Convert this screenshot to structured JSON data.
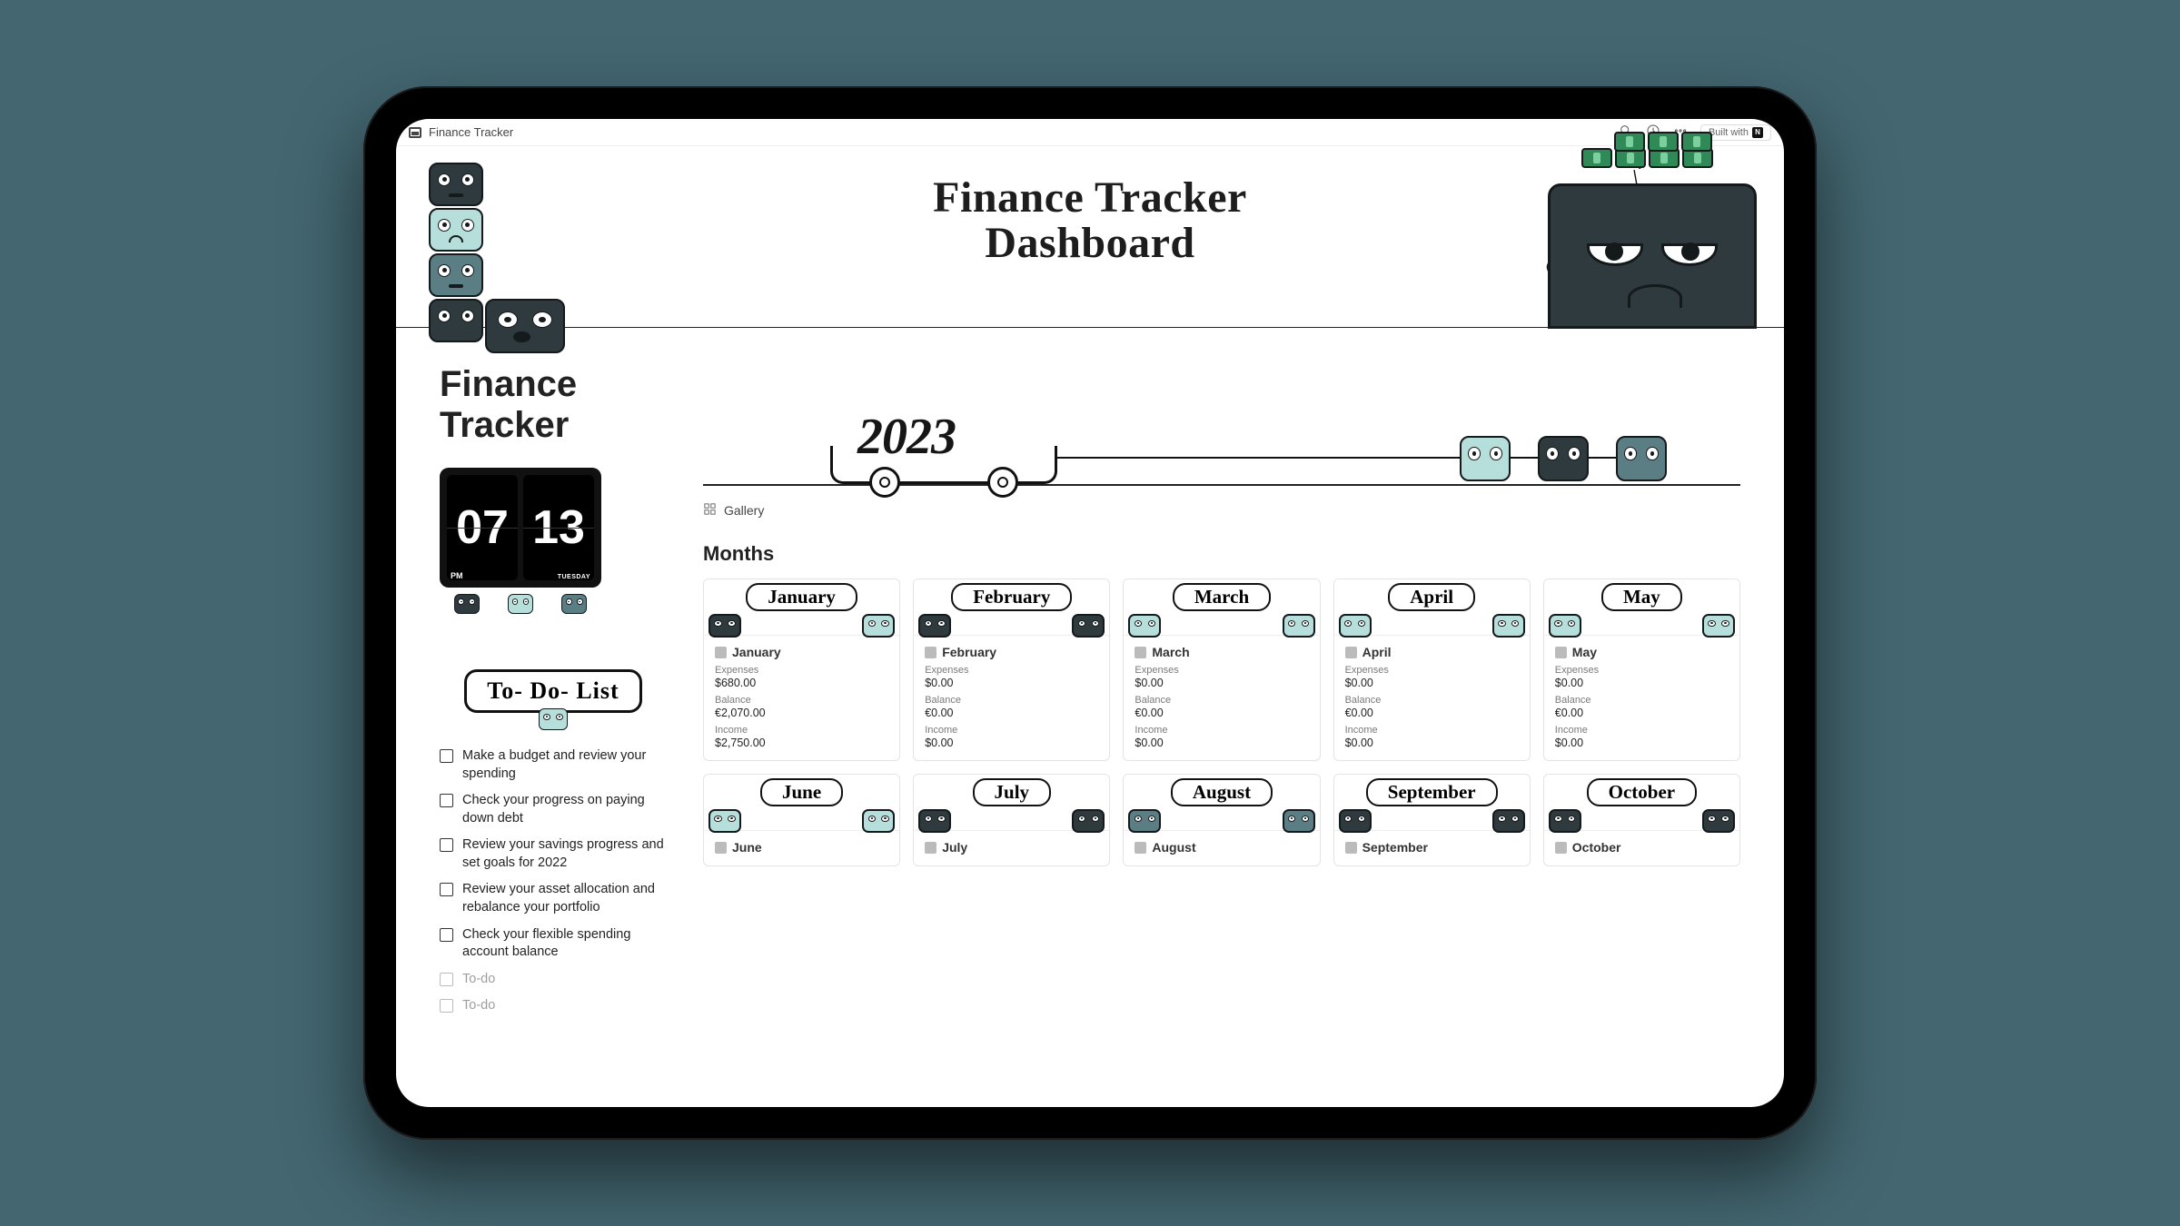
{
  "topbar": {
    "breadcrumb": "Finance Tracker",
    "built_with": "Built with"
  },
  "hero": {
    "title_line1": "Finance Tracker",
    "title_line2": "Dashboard"
  },
  "page_title": "Finance Tracker",
  "clock": {
    "hour": "07",
    "minute": "13",
    "ampm": "PM",
    "dow": "TUESDAY"
  },
  "illustration": {
    "year": "2023"
  },
  "tabs": {
    "gallery": "Gallery"
  },
  "section": {
    "months": "Months"
  },
  "todo": {
    "title": "To- Do- List",
    "items": [
      {
        "text": "Make a budget and review your spending",
        "done": false
      },
      {
        "text": "Check your progress on paying down debt",
        "done": false
      },
      {
        "text": "Review your savings progress and set goals for 2022",
        "done": false
      },
      {
        "text": "Review your asset allocation and rebalance your portfolio",
        "done": false
      },
      {
        "text": "Check your flexible spending account balance",
        "done": false
      },
      {
        "text": "To-do",
        "done": true
      },
      {
        "text": "To-do",
        "done": true
      }
    ]
  },
  "labels": {
    "expenses": "Expenses",
    "balance": "Balance",
    "income": "Income"
  },
  "months_row1": [
    {
      "name": "January",
      "expenses": "$680.00",
      "balance": "€2,070.00",
      "income": "$2,750.00"
    },
    {
      "name": "February",
      "expenses": "$0.00",
      "balance": "€0.00",
      "income": "$0.00"
    },
    {
      "name": "March",
      "expenses": "$0.00",
      "balance": "€0.00",
      "income": "$0.00"
    },
    {
      "name": "April",
      "expenses": "$0.00",
      "balance": "€0.00",
      "income": "$0.00"
    },
    {
      "name": "May",
      "expenses": "$0.00",
      "balance": "€0.00",
      "income": "$0.00"
    }
  ],
  "months_row2": [
    {
      "name": "June"
    },
    {
      "name": "July"
    },
    {
      "name": "August"
    },
    {
      "name": "September"
    },
    {
      "name": "October"
    }
  ],
  "icon_names": {
    "search": "search-icon",
    "clock": "clock-icon",
    "more": "more-icon",
    "gallery": "gallery-view-icon",
    "page": "page-icon"
  },
  "colors": {
    "page_bg": "#436670",
    "block_dark": "#2e3a3d",
    "block_light": "#b6dedb",
    "block_grey": "#5a7e83",
    "cash_green": "#2f8a57"
  }
}
